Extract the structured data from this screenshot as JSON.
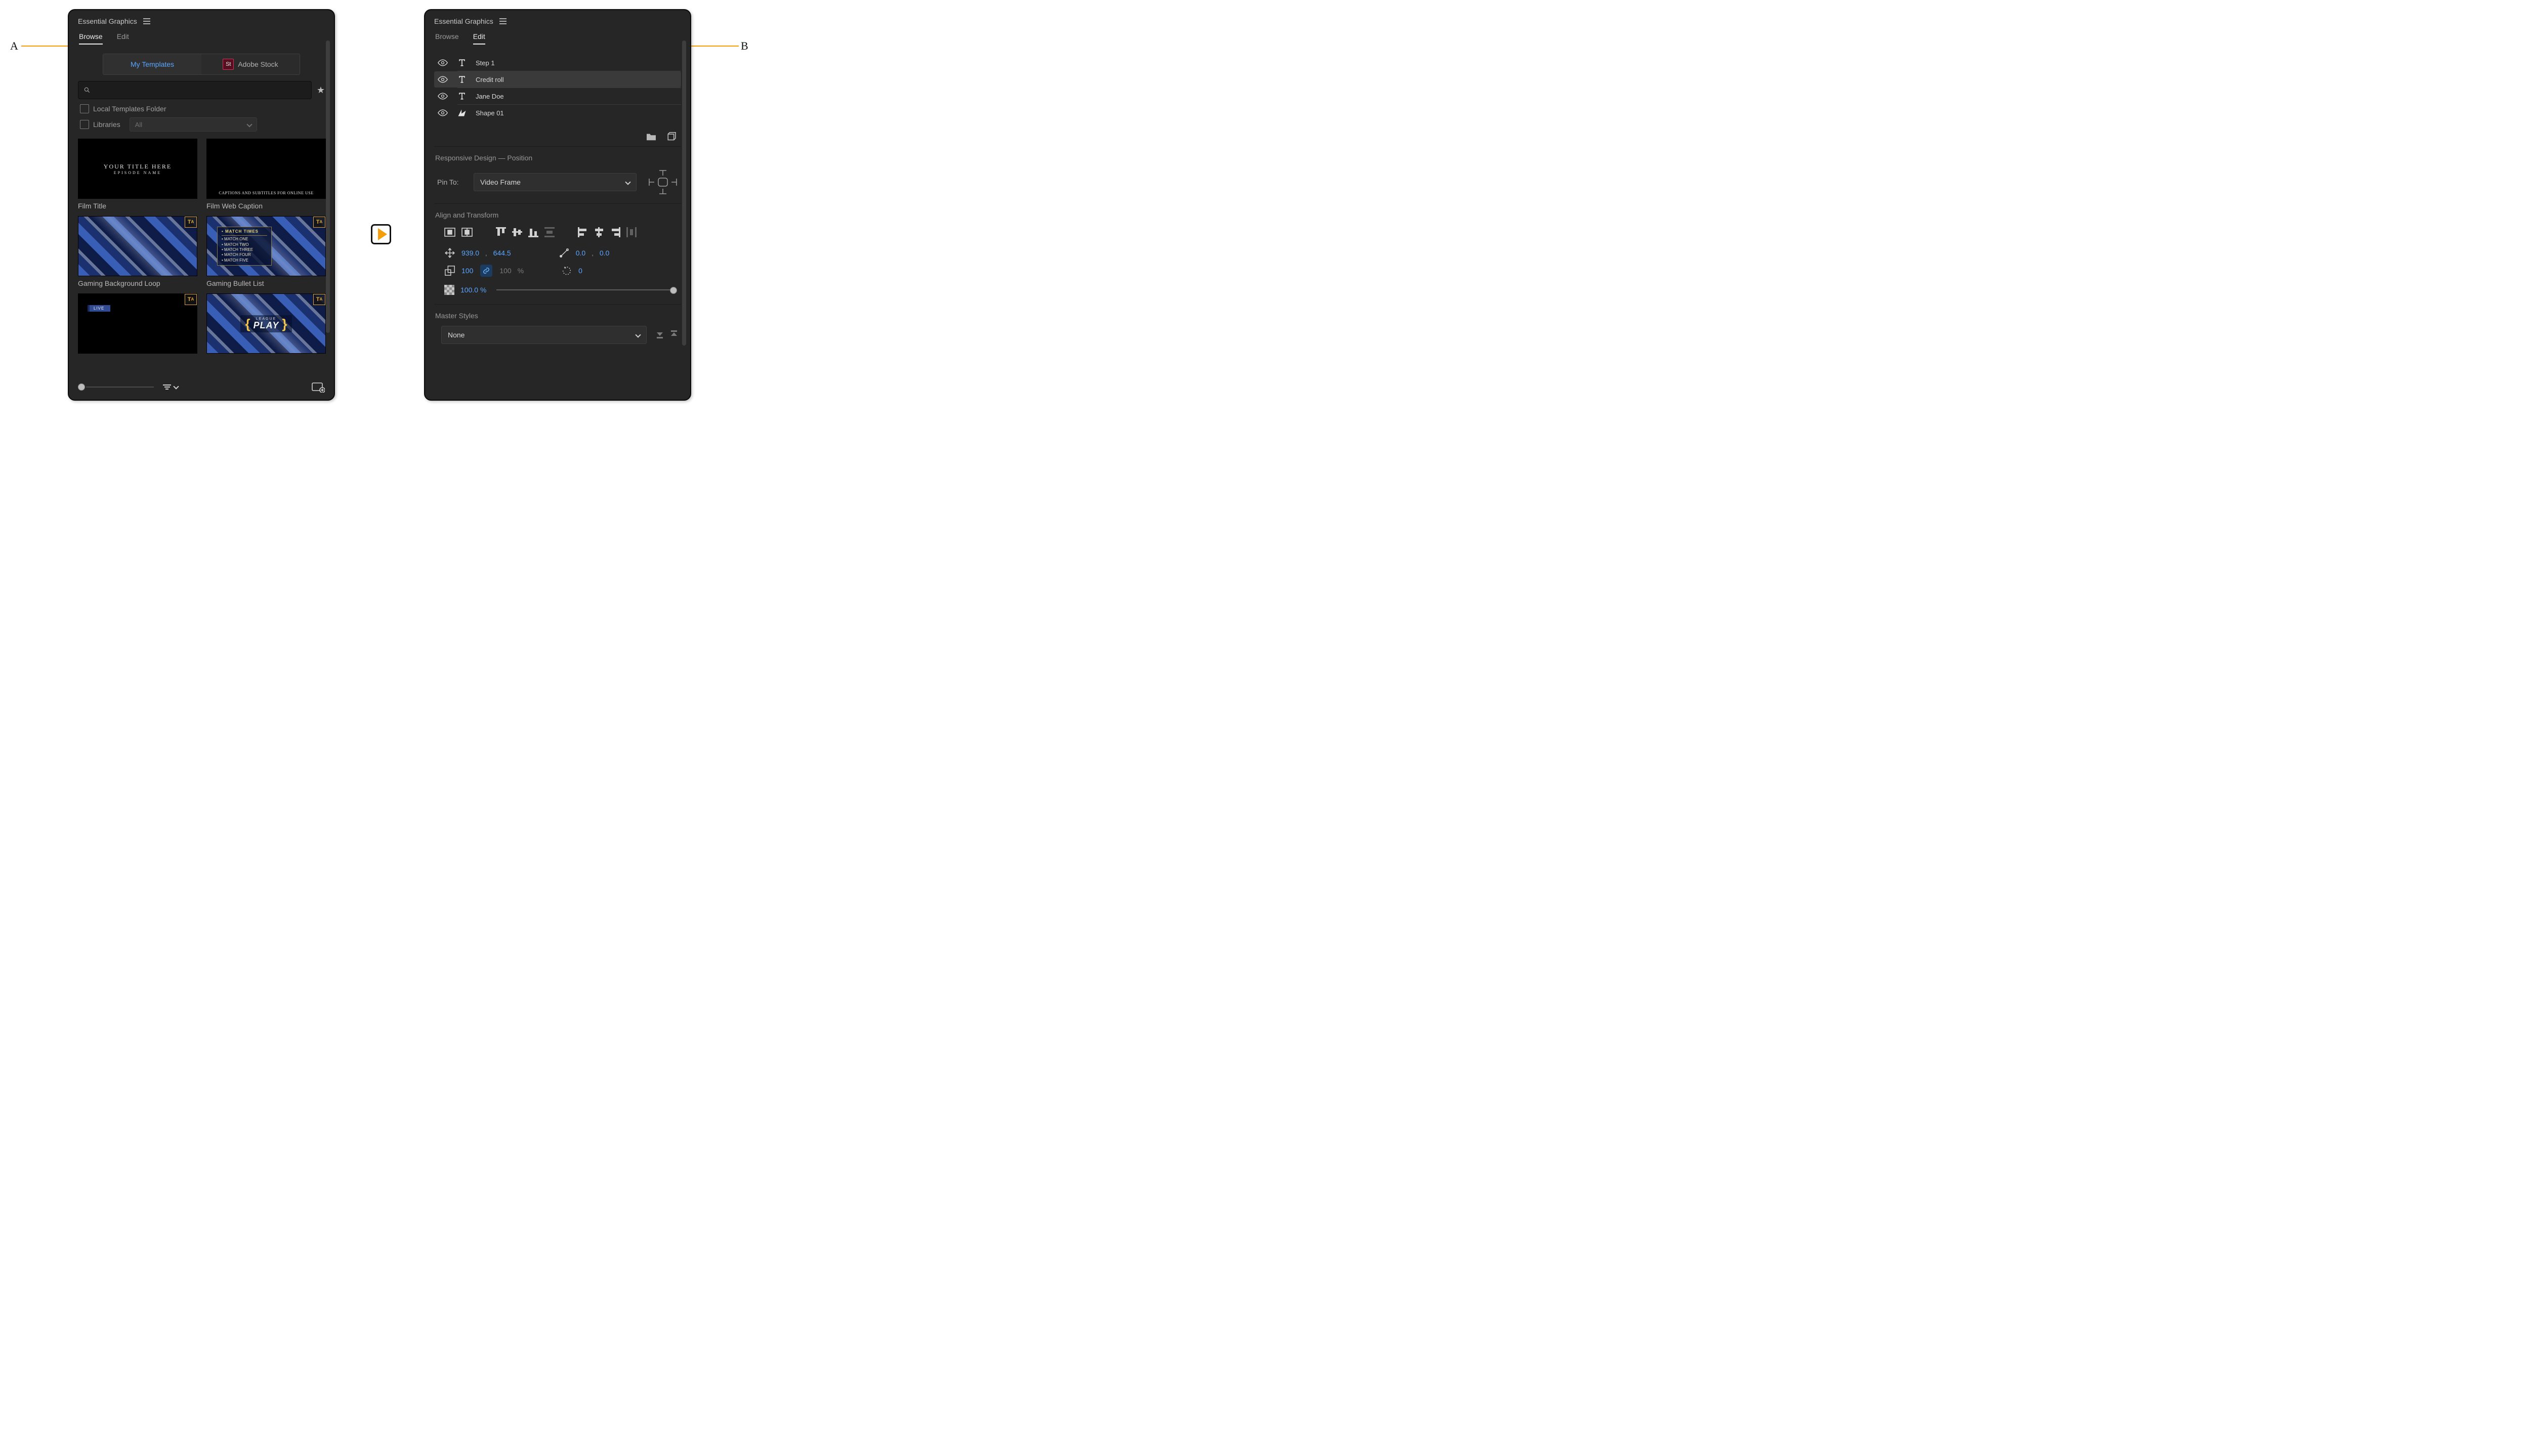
{
  "panel_title": "Essential Graphics",
  "annotations": {
    "A": "A",
    "B": "B"
  },
  "tabs": {
    "browse": "Browse",
    "edit": "Edit"
  },
  "browse": {
    "seg": {
      "my_templates": "My Templates",
      "adobe_stock": "Adobe Stock",
      "stock_badge": "St"
    },
    "filters": {
      "local_folder": "Local Templates Folder",
      "libraries": "Libraries",
      "libraries_value": "All"
    },
    "templates": [
      {
        "label": "Film Title",
        "title_line1": "YOUR TITLE HERE",
        "title_line2": "EPISODE NAME"
      },
      {
        "label": "Film Web Caption",
        "caption_text": "Captions and Subtitles for online use"
      },
      {
        "label": "Gaming Background Loop"
      },
      {
        "label": "Gaming Bullet List",
        "header": "MATCH TIMES",
        "items": [
          "MATCH ONE",
          "MATCH TWO",
          "MATCH THREE",
          "MATCH FOUR",
          "MATCH FIVE"
        ]
      },
      {
        "label": "",
        "live_text": "LIVE"
      },
      {
        "label": "",
        "play_top": "LEAGUE",
        "play_main": "PLAY"
      }
    ]
  },
  "edit": {
    "layers": [
      {
        "name": "Step 1",
        "icon": "text",
        "selected": false
      },
      {
        "name": "Credit roll",
        "icon": "text",
        "selected": true
      },
      {
        "name": "Jane Doe",
        "icon": "text",
        "selected": false
      },
      {
        "name": "Shape 01",
        "icon": "shape",
        "selected": false
      }
    ],
    "responsive": {
      "title": "Responsive Design — Position",
      "pin_label": "Pin To:",
      "pin_value": "Video Frame"
    },
    "align_title": "Align and Transform",
    "transform": {
      "pos_x": "939.0",
      "pos_y": "644.5",
      "anchor_x": "0.0",
      "anchor_y": "0.0",
      "scale_w": "100",
      "scale_h": "100",
      "scale_unit": "%",
      "rotation": "0",
      "opacity": "100.0 %"
    },
    "master": {
      "title": "Master Styles",
      "value": "None"
    }
  }
}
